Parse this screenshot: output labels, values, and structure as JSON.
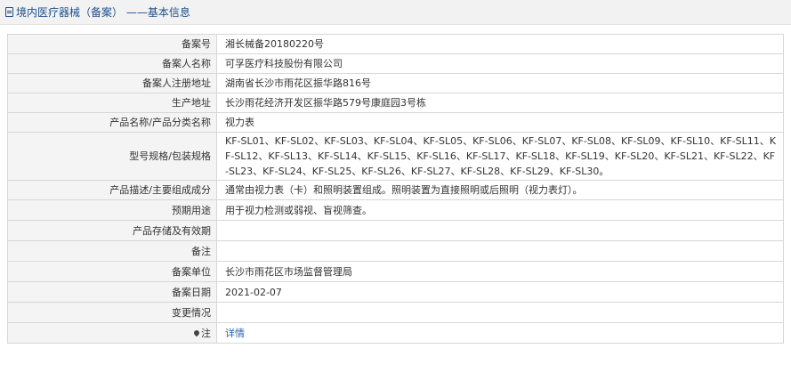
{
  "header": {
    "title": "境内医疗器械（备案） ——基本信息"
  },
  "rows": [
    {
      "label": "备案号",
      "value": "湘长械备20180220号"
    },
    {
      "label": "备案人名称",
      "value": "可孚医疗科技股份有限公司"
    },
    {
      "label": "备案人注册地址",
      "value": "湖南省长沙市雨花区振华路816号"
    },
    {
      "label": "生产地址",
      "value": "长沙雨花经济开发区振华路579号康庭园3号栋"
    },
    {
      "label": "产品名称/产品分类名称",
      "value": "视力表"
    },
    {
      "label": "型号规格/包装规格",
      "value": "KF-SL01、KF-SL02、KF-SL03、KF-SL04、KF-SL05、KF-SL06、KF-SL07、KF-SL08、KF-SL09、KF-SL10、KF-SL11、KF-SL12、KF-SL13、KF-SL14、KF-SL15、KF-SL16、KF-SL17、KF-SL18、KF-SL19、KF-SL20、KF-SL21、KF-SL22、KF-SL23、KF-SL24、KF-SL25、KF-SL26、KF-SL27、KF-SL28、KF-SL29、KF-SL30。"
    },
    {
      "label": "产品描述/主要组成成分",
      "value": "通常由视力表（卡）和照明装置组成。照明装置为直接照明或后照明（视力表灯）。"
    },
    {
      "label": "预期用途",
      "value": "用于视力检测或弱视、盲视筛查。"
    },
    {
      "label": "产品存储及有效期",
      "value": ""
    },
    {
      "label": "备注",
      "value": ""
    },
    {
      "label": "备案单位",
      "value": "长沙市雨花区市场监督管理局"
    },
    {
      "label": "备案日期",
      "value": "2021-02-07"
    },
    {
      "label": "变更情况",
      "value": ""
    }
  ],
  "note": {
    "label": "注",
    "icon": "pin-icon",
    "link_text": "详情"
  }
}
